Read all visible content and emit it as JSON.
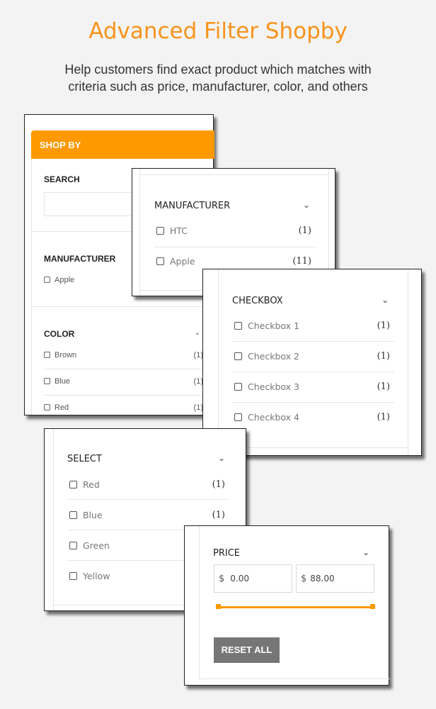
{
  "header": {
    "title": "Advanced Filter Shopby",
    "subtitle_line1": "Help customers find exact product which matches with",
    "subtitle_line2": "criteria such as price, manufacturer, color, and others"
  },
  "colors": {
    "accent": "#ff9900",
    "title": "#f7941d",
    "reset_button": "#767676",
    "background": "#f3f3f3"
  },
  "shopby": {
    "header_label": "SHOP BY",
    "search_label": "SEARCH",
    "search_value": "",
    "manufacturer_label": "MANUFACTURER",
    "manufacturer_items": [
      {
        "label": "Apple"
      }
    ],
    "color_label": "COLOR",
    "color_items": [
      {
        "label": "Brown",
        "count": "(1)"
      },
      {
        "label": "Blue",
        "count": "(1)"
      },
      {
        "label": "Red",
        "count": "(1)"
      }
    ]
  },
  "manufacturer": {
    "title": "MANUFACTURER",
    "items": [
      {
        "label": "HTC",
        "count": "(1)"
      },
      {
        "label": "Apple",
        "count": "(11)"
      }
    ]
  },
  "checkbox": {
    "title": "CHECKBOX",
    "items": [
      {
        "label": "Checkbox 1",
        "count": "(1)"
      },
      {
        "label": "Checkbox 2",
        "count": "(1)"
      },
      {
        "label": "Checkbox 3",
        "count": "(1)"
      },
      {
        "label": "Checkbox 4",
        "count": "(1)"
      }
    ]
  },
  "select": {
    "title": "SELECT",
    "items": [
      {
        "label": "Red",
        "count": "(1)"
      },
      {
        "label": "Blue",
        "count": "(1)"
      },
      {
        "label": "Green",
        "count": ""
      },
      {
        "label": "Yellow",
        "count": ""
      }
    ]
  },
  "price": {
    "title": "PRICE",
    "currency": "$",
    "min_value": "0.00",
    "max_value": "88.00",
    "slider_min_fraction": 0,
    "slider_max_fraction": 1,
    "reset_label": "RESET ALL"
  },
  "icons": {
    "chevron": "chevron-down-icon",
    "checkbox": "checkbox-icon"
  }
}
